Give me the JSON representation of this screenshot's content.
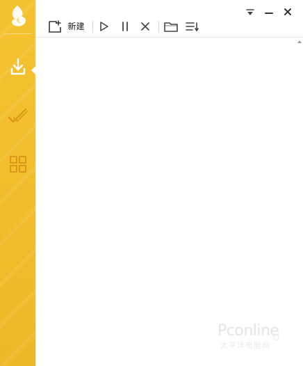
{
  "sidebar": {
    "logo_icon": "flame-logo-icon",
    "items": [
      {
        "name": "downloading",
        "icon": "download-tray-icon",
        "active": true
      },
      {
        "name": "completed",
        "icon": "double-check-icon",
        "active": false
      },
      {
        "name": "apps",
        "icon": "grid-4-icon",
        "active": false
      }
    ],
    "colors": {
      "bg": "#f2bd2c",
      "icon_active": "#ffffff",
      "icon_inactive": "#d99a1a"
    }
  },
  "toolbar": {
    "new_label": "新建",
    "buttons": [
      {
        "id": "new",
        "icon": "new-task-icon"
      },
      {
        "id": "start",
        "icon": "play-icon"
      },
      {
        "id": "pause",
        "icon": "pause-icon"
      },
      {
        "id": "delete",
        "icon": "close-x-icon"
      },
      {
        "id": "open-folder",
        "icon": "folder-icon"
      },
      {
        "id": "sort",
        "icon": "sort-list-icon"
      }
    ]
  },
  "window": {
    "controls": [
      {
        "id": "menu",
        "icon": "dropdown-menu-icon"
      },
      {
        "id": "minimize",
        "icon": "minimize-icon"
      },
      {
        "id": "close",
        "icon": "close-window-icon"
      }
    ]
  },
  "watermark": {
    "title": "Pconline",
    "subtitle": "太平洋电脑网"
  }
}
